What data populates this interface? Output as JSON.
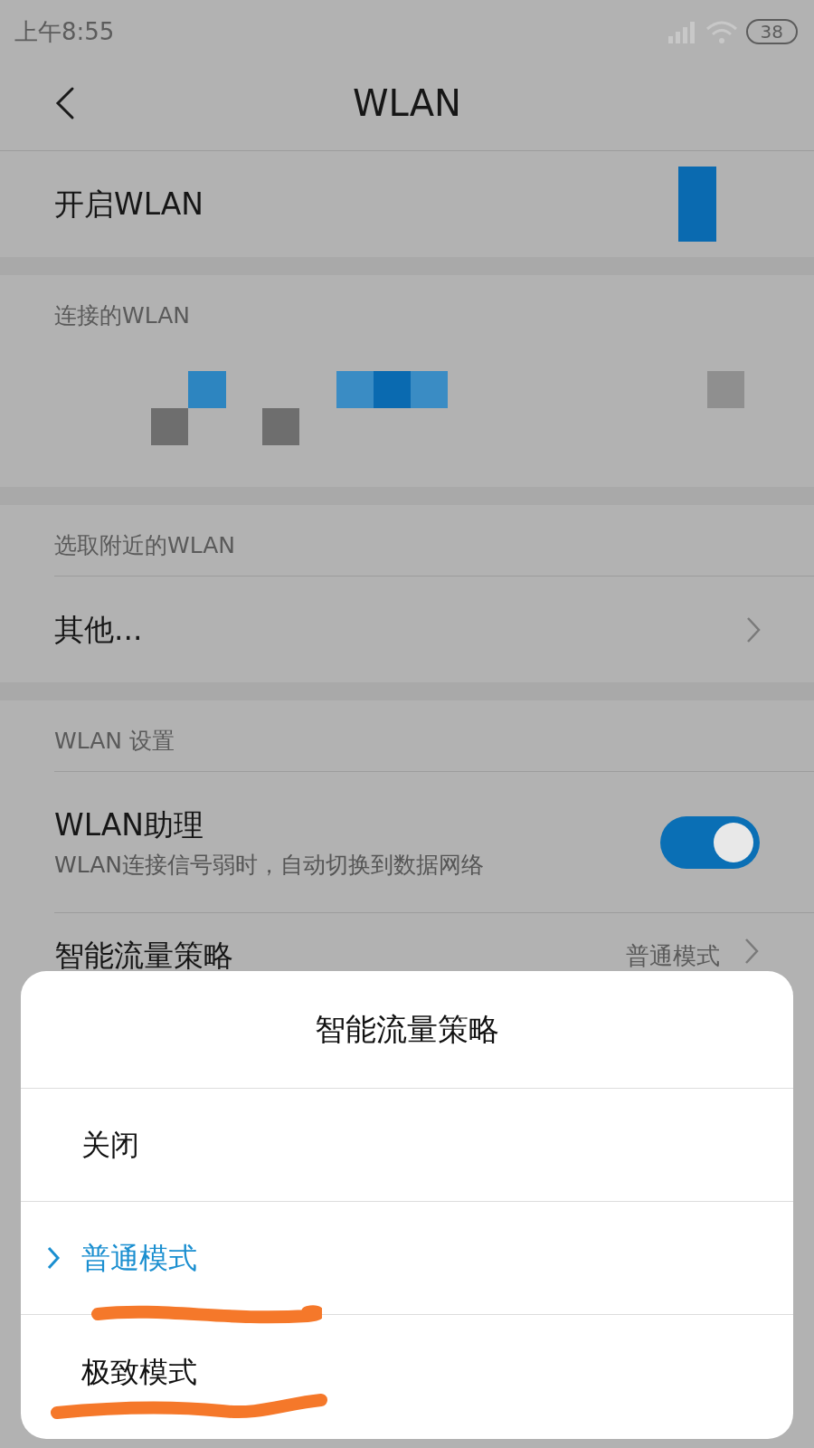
{
  "status_bar": {
    "time": "上午8:55",
    "battery": "38"
  },
  "header": {
    "title": "WLAN"
  },
  "wlan_switch": {
    "label": "开启WLAN"
  },
  "connected": {
    "title": "连接的WLAN"
  },
  "nearby": {
    "title": "选取附近的WLAN",
    "items": [
      {
        "label": "其他..."
      }
    ]
  },
  "settings": {
    "title": "WLAN 设置",
    "items": [
      {
        "kind": "toggle",
        "label": "WLAN助理",
        "description": "WLAN连接信号弱时，自动切换到数据网络",
        "on": true
      },
      {
        "kind": "value",
        "label": "智能流量策略",
        "value": "普通模式"
      }
    ]
  },
  "dialog": {
    "title": "智能流量策略",
    "options": [
      {
        "label": "关闭",
        "selected": false
      },
      {
        "label": "普通模式",
        "selected": true
      },
      {
        "label": "极致模式",
        "selected": false
      }
    ]
  }
}
